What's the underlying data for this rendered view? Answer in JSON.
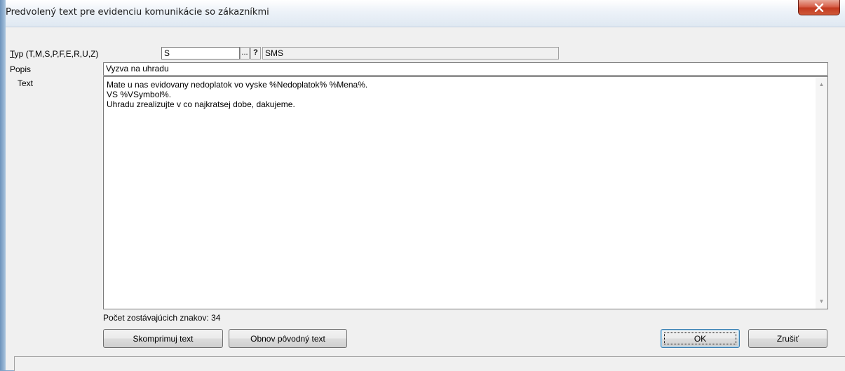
{
  "window": {
    "title": "Predvolený text pre evidenciu komunikácie so zákazníkmi",
    "close_icon": "close-icon"
  },
  "form": {
    "typ": {
      "label_accel": "T",
      "label_rest": "yp (T,M,S,P,F,E,R,U,Z)",
      "value": "S",
      "browse_label": "...",
      "help_label": "?",
      "description": "SMS"
    },
    "popis": {
      "label": "Popis",
      "value": "Vyzva na uhradu"
    },
    "text": {
      "label": "Text",
      "value": "Mate u nas evidovany nedoplatok vo vyske %Nedoplatok% %Mena%.\nVS %VSymbol%.\nUhradu zrealizujte v co najkratsej dobe, dakujeme."
    },
    "remaining": "Počet zostávajúcich znakov: 34"
  },
  "buttons": {
    "compress": "Skomprimuj text",
    "restore": "Obnov pôvodný text",
    "ok": "OK",
    "cancel": "Zrušiť"
  }
}
